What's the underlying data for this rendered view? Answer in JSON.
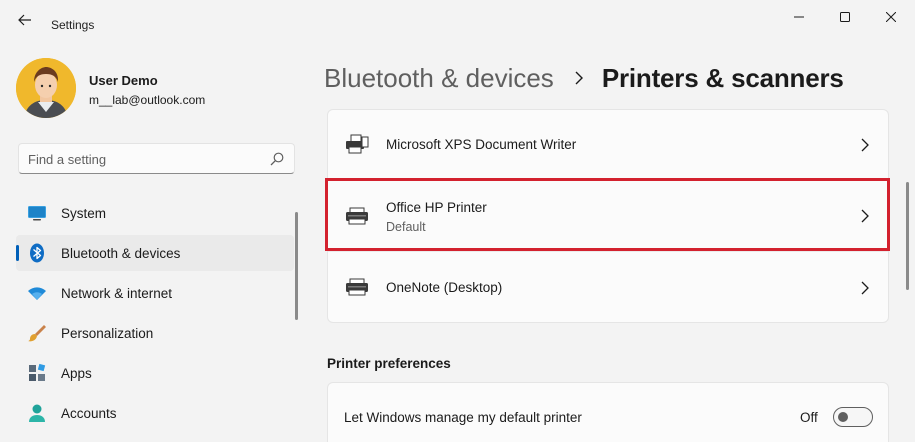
{
  "window": {
    "title": "Settings"
  },
  "user": {
    "name": "User Demo",
    "email": "m__lab@outlook.com"
  },
  "search": {
    "placeholder": "Find a setting"
  },
  "sidebar": {
    "items": [
      {
        "label": "System",
        "icon": "system-icon",
        "active": false
      },
      {
        "label": "Bluetooth & devices",
        "icon": "bluetooth-icon",
        "active": true
      },
      {
        "label": "Network & internet",
        "icon": "wifi-icon",
        "active": false
      },
      {
        "label": "Personalization",
        "icon": "brush-icon",
        "active": false
      },
      {
        "label": "Apps",
        "icon": "apps-icon",
        "active": false
      },
      {
        "label": "Accounts",
        "icon": "accounts-icon",
        "active": false
      }
    ]
  },
  "breadcrumb": {
    "parent": "Bluetooth & devices",
    "current": "Printers & scanners"
  },
  "printers": [
    {
      "name": "Microsoft XPS Document Writer",
      "status": ""
    },
    {
      "name": "Office HP Printer",
      "status": "Default"
    },
    {
      "name": "OneNote (Desktop)",
      "status": ""
    }
  ],
  "preferences": {
    "section_title": "Printer preferences",
    "default_printer": {
      "label": "Let Windows manage my default printer",
      "state": "Off"
    }
  },
  "colors": {
    "accent": "#005fb8",
    "highlight": "#d3212e",
    "background": "#f3f3f3"
  }
}
